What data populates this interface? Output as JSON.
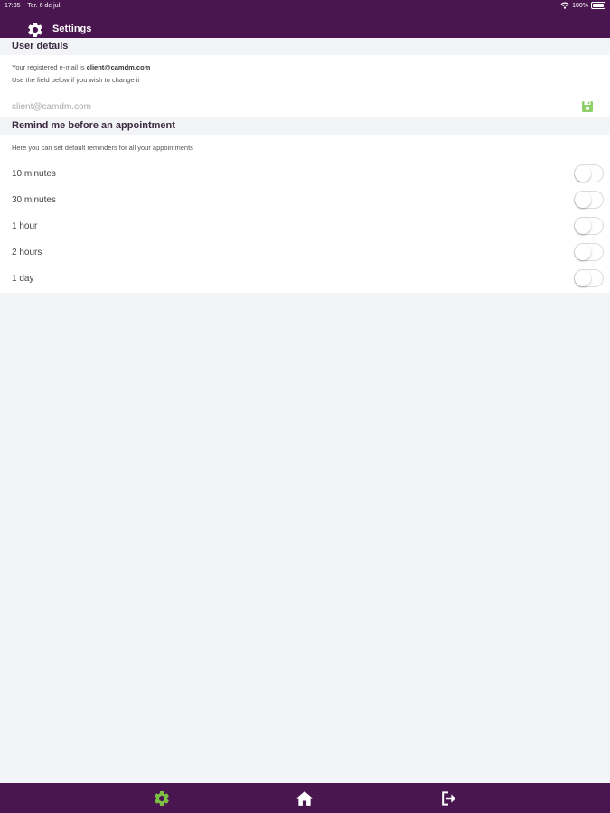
{
  "status_bar": {
    "time": "17:35",
    "date": "Ter. 6 de jul.",
    "battery": "100%"
  },
  "nav": {
    "title": "Settings",
    "icon": "gear-icon"
  },
  "user_details": {
    "header": "User details",
    "registered_prefix": "Your registered e-mail is ",
    "registered_email": "client@camdm.com",
    "change_hint": "Use the field below if you wish to change it",
    "email_placeholder": "client@camdm.com",
    "save_icon": "floppy-disk-icon"
  },
  "reminders": {
    "header": "Remind me before an appointment",
    "description": "Here you can set default reminders for all your appointments",
    "options": [
      {
        "label": "10 minutes",
        "enabled": false
      },
      {
        "label": "30 minutes",
        "enabled": false
      },
      {
        "label": "1 hour",
        "enabled": false
      },
      {
        "label": "2 hours",
        "enabled": false
      },
      {
        "label": "1 day",
        "enabled": false
      }
    ]
  },
  "tab_bar": {
    "tabs": [
      {
        "name": "settings",
        "icon": "gear-icon",
        "active": true
      },
      {
        "name": "home",
        "icon": "home-icon",
        "active": false
      },
      {
        "name": "logout",
        "icon": "logout-icon",
        "active": false
      }
    ]
  },
  "colors": {
    "brand_purple": "#4a1650",
    "active_green": "#7cc043",
    "save_green": "#8fcf6a",
    "background": "#f3f4f8"
  }
}
